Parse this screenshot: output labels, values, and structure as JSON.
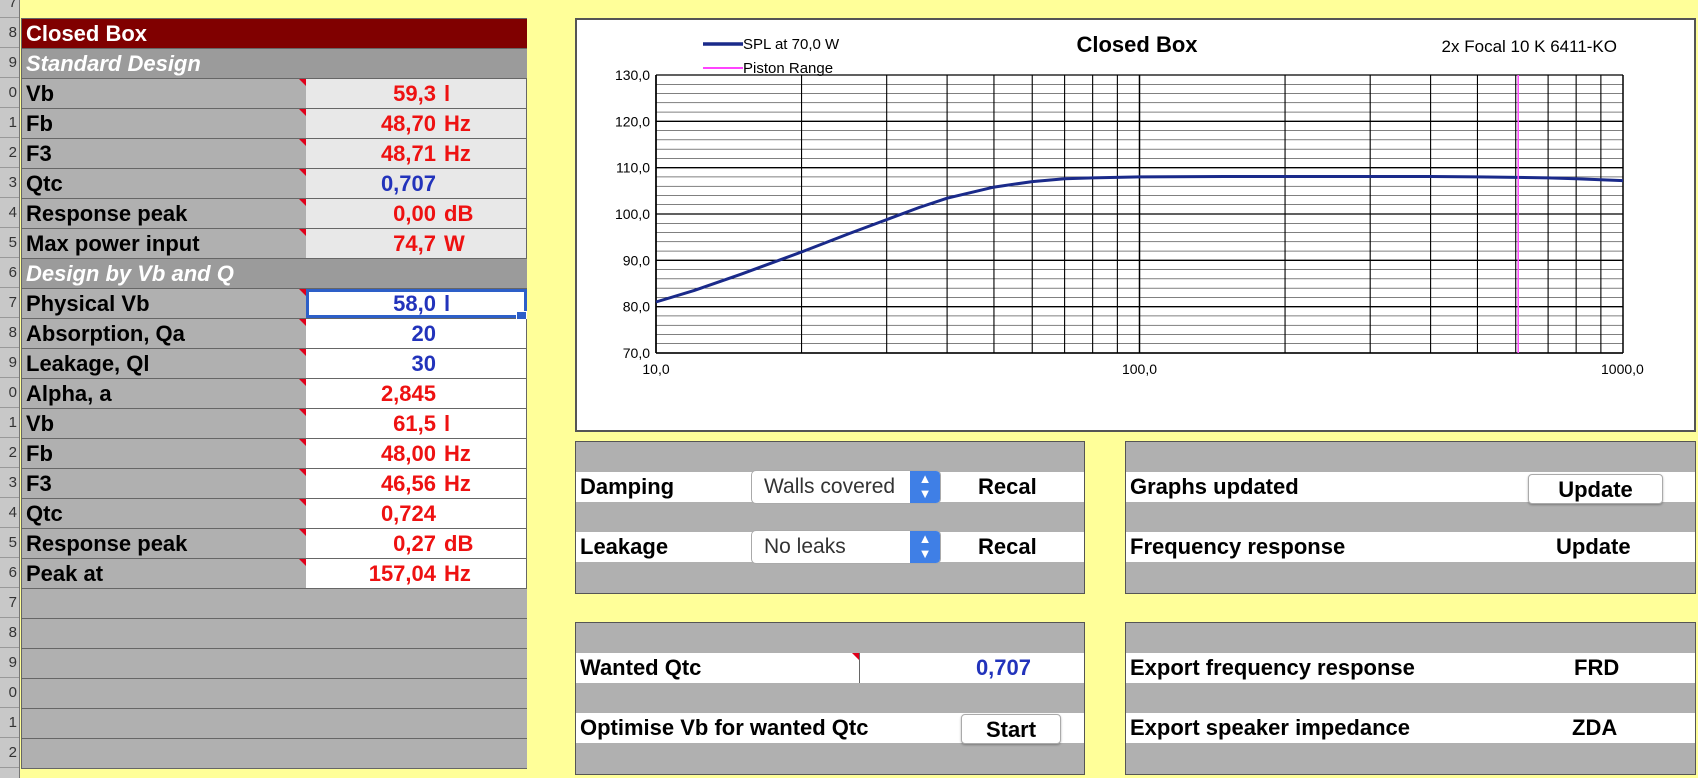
{
  "sheet": {
    "title": "Closed Box",
    "section1": "Standard Design",
    "rows1": [
      {
        "label": "Vb",
        "value": "59,3",
        "unit": "l",
        "color": "red"
      },
      {
        "label": "Fb",
        "value": "48,70",
        "unit": "Hz",
        "color": "red"
      },
      {
        "label": "F3",
        "value": "48,71",
        "unit": "Hz",
        "color": "red"
      },
      {
        "label": "Qtc",
        "value": "0,707",
        "unit": "",
        "color": "blue"
      },
      {
        "label": "Response peak",
        "value": "0,00",
        "unit": "dB",
        "color": "red"
      },
      {
        "label": "Max power input",
        "value": "74,7",
        "unit": "W",
        "color": "red"
      }
    ],
    "section2": "Design by Vb and Q",
    "rows2": [
      {
        "label": "Physical Vb",
        "value": "58,0",
        "unit": "l",
        "color": "blue"
      },
      {
        "label": "Absorption, Qa",
        "value": "20",
        "unit": "",
        "color": "blue"
      },
      {
        "label": "Leakage, Ql",
        "value": "30",
        "unit": "",
        "color": "blue"
      },
      {
        "label": "Alpha, a",
        "value": "2,845",
        "unit": "",
        "color": "red"
      },
      {
        "label": "Vb",
        "value": "61,5",
        "unit": "l",
        "color": "red"
      },
      {
        "label": "Fb",
        "value": "48,00",
        "unit": "Hz",
        "color": "red"
      },
      {
        "label": "F3",
        "value": "46,56",
        "unit": "Hz",
        "color": "red"
      },
      {
        "label": "Qtc",
        "value": "0,724",
        "unit": "",
        "color": "red"
      },
      {
        "label": "Response peak",
        "value": "0,27",
        "unit": "dB",
        "color": "red"
      },
      {
        "label": "Peak at",
        "value": "157,04",
        "unit": "Hz",
        "color": "red"
      }
    ]
  },
  "panels": {
    "damping_label": "Damping",
    "damping_value": "Walls covered",
    "leakage_label": "Leakage",
    "leakage_value": "No leaks",
    "recal": "Recal",
    "graphs_updated": "Graphs updated",
    "frequency_response": "Frequency response",
    "update": "Update",
    "wanted_qtc_label": "Wanted Qtc",
    "wanted_qtc_value": "0,707",
    "optimise_label": "Optimise Vb for wanted Qtc",
    "start": "Start",
    "export_freq": "Export frequency response",
    "frd": "FRD",
    "export_imp": "Export speaker impedance",
    "zda": "ZDA"
  },
  "chart_data": {
    "type": "line",
    "title": "Closed Box",
    "subtitle": "2x Focal 10 K 6411-KO",
    "xscale": "log",
    "xlim": [
      10,
      1000
    ],
    "ylim": [
      70,
      130
    ],
    "xticks": [
      "10,0",
      "100,0",
      "1000,0"
    ],
    "yticks": [
      "70,0",
      "80,0",
      "90,0",
      "100,0",
      "110,0",
      "120,0",
      "130,0"
    ],
    "grid": true,
    "legend": "top-left",
    "series": [
      {
        "name": "SPL at 70,0 W",
        "color": "#1a2a8a",
        "x": [
          10,
          12,
          15,
          20,
          25,
          30,
          35,
          40,
          50,
          60,
          70,
          80,
          100,
          150,
          200,
          300,
          400,
          500,
          600,
          700,
          800,
          900,
          1000
        ],
        "y": [
          81.0,
          83.5,
          87.0,
          91.8,
          95.7,
          98.8,
          101.4,
          103.4,
          105.8,
          107.0,
          107.6,
          107.8,
          108.0,
          108.1,
          108.1,
          108.1,
          108.1,
          108.0,
          107.9,
          107.8,
          107.6,
          107.4,
          107.2
        ]
      },
      {
        "name": "Piston Range",
        "color": "#ff44ff",
        "x": [
          607,
          607
        ],
        "y": [
          70,
          130
        ]
      }
    ]
  }
}
